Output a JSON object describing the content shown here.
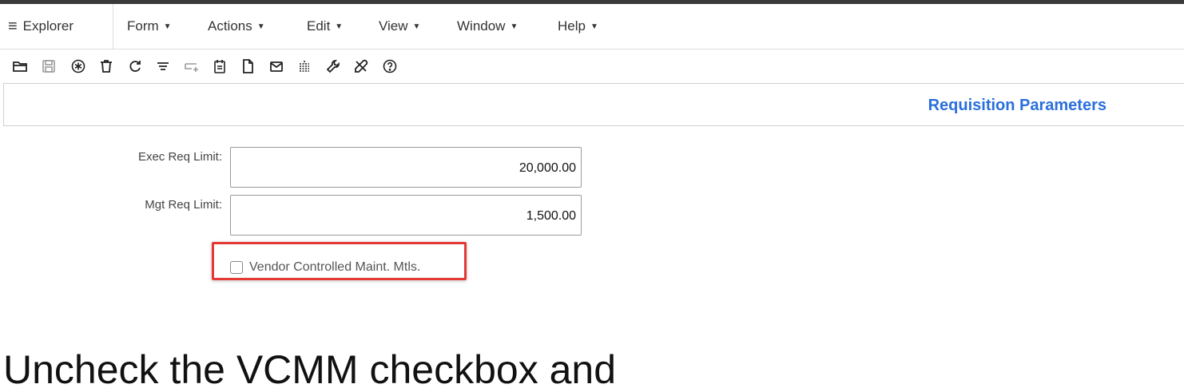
{
  "menubar": {
    "explorer_label": "Explorer",
    "items": [
      {
        "label": "Form"
      },
      {
        "label": "Actions"
      },
      {
        "label": "Edit"
      },
      {
        "label": "View"
      },
      {
        "label": "Window"
      },
      {
        "label": "Help"
      }
    ]
  },
  "toolbar": {
    "icons": [
      "open-folder-icon",
      "save-icon",
      "new-asterisk-icon",
      "delete-trash-icon",
      "refresh-icon",
      "filter-icon",
      "add-row-icon",
      "notes-icon",
      "document-icon",
      "email-icon",
      "hierarchy-icon",
      "wrench-icon",
      "tools-icon",
      "help-icon"
    ]
  },
  "page": {
    "title": "Requisition Parameters"
  },
  "fields": {
    "exec_req_limit": {
      "label": "Exec Req Limit:",
      "value": "20,000.00"
    },
    "mgt_req_limit": {
      "label": "Mgt Req Limit:",
      "value": "1,500.00"
    }
  },
  "checkbox": {
    "label": "Vendor Controlled Maint. Mtls.",
    "checked": false
  },
  "caption": {
    "text": "Uncheck the VCMM checkbox and"
  },
  "colors": {
    "title_blue": "#2a6fdb",
    "highlight_red": "#e53935",
    "topbar_dark": "#3a3a3a"
  }
}
